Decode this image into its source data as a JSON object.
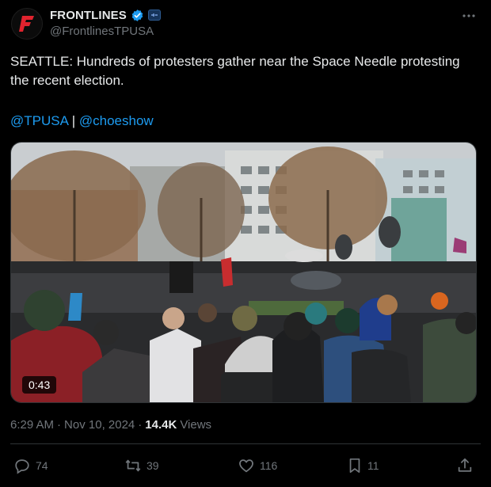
{
  "author": {
    "display_name": "FRONTLINES",
    "handle": "@FrontlinesTPUSA",
    "avatar_letter": "F",
    "avatar_color": "#e0232e",
    "verified_color": "#1d9bf0"
  },
  "tweet": {
    "text": "SEATTLE: Hundreds of protesters gather near the Space Needle protesting the recent election.",
    "mentions": [
      "@TPUSA",
      "@choeshow"
    ],
    "mention_separator": "|"
  },
  "media": {
    "type": "video",
    "duration": "0:43"
  },
  "meta": {
    "time": "6:29 AM",
    "dot": "·",
    "date": "Nov 10, 2024",
    "dot2": "·",
    "views_count": "14.4K",
    "views_label": "Views"
  },
  "actions": {
    "replies": "74",
    "reposts": "39",
    "likes": "116",
    "bookmarks": "11"
  },
  "colors": {
    "background": "#000000",
    "text": "#e7e9ea",
    "muted": "#71767b",
    "link": "#1d9bf0"
  }
}
